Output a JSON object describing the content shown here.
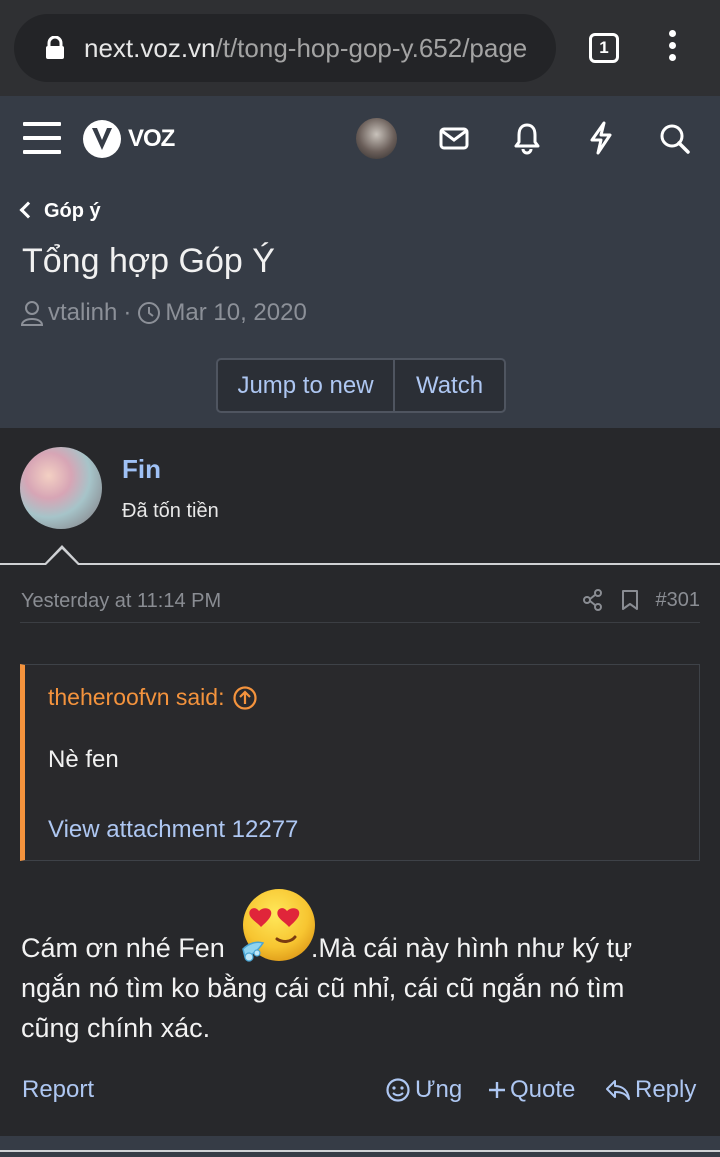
{
  "browser": {
    "url_host": "next.voz.vn",
    "url_path": "/t/tong-hop-gop-y.652/page",
    "tab_count": "1"
  },
  "header": {
    "logo_text": "VOZ"
  },
  "thread": {
    "breadcrumb": "Góp ý",
    "title": "Tổng hợp Góp Ý",
    "starter": "vtalinh",
    "start_date": "Mar 10, 2020",
    "jump_label": "Jump to new",
    "watch_label": "Watch"
  },
  "post": {
    "author": "Fin",
    "author_title": "Đã tốn tiền",
    "time": "Yesterday at 11:14 PM",
    "number": "#301",
    "quote_author": "theheroofvn said:",
    "quote_body": "Nè fen",
    "quote_attachment": "View attachment 12277",
    "message_line1_a": "Cám ơn nhé Fen",
    "message_line1_b": ".Mà cái này hình như ký tự",
    "message_line2": "ngắn nó tìm ko bằng cái cũ nhỉ, cái cũ ngắn nó tìm",
    "message_line3": "cũng chính xác.",
    "report_label": "Report",
    "react_label": "Ưng",
    "quote_label": "Quote",
    "reply_label": "Reply"
  },
  "colors": {
    "link": "#aec7f2",
    "quote_accent": "#f4933d",
    "header_bg": "#363c46",
    "post_bg": "#27282b"
  }
}
